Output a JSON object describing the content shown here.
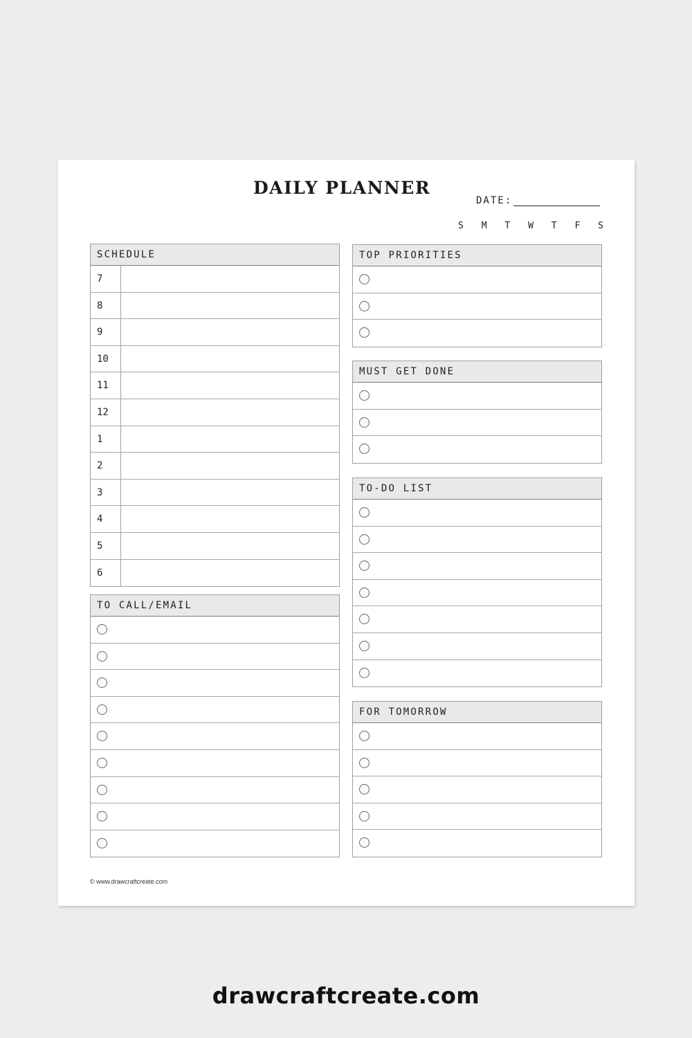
{
  "planner": {
    "title": "DAILY PLANNER",
    "date_label": "DATE:",
    "days": [
      "S",
      "M",
      "T",
      "W",
      "T",
      "F",
      "S"
    ],
    "schedule": {
      "title": "SCHEDULE",
      "hours": [
        "7",
        "8",
        "9",
        "10",
        "11",
        "12",
        "1",
        "2",
        "3",
        "4",
        "5",
        "6"
      ]
    },
    "to_call_email": {
      "title": "TO CALL/EMAIL",
      "rows": 9
    },
    "top_priorities": {
      "title": "TOP PRIORITIES",
      "rows": 3
    },
    "must_get_done": {
      "title": "MUST GET DONE",
      "rows": 3
    },
    "todo_list": {
      "title": "TO-DO LIST",
      "rows": 7
    },
    "for_tomorrow": {
      "title": "FOR TOMORROW",
      "rows": 5
    },
    "copyright": "© www.drawcraftcreate.com"
  },
  "brand": "drawcraftcreate.com"
}
